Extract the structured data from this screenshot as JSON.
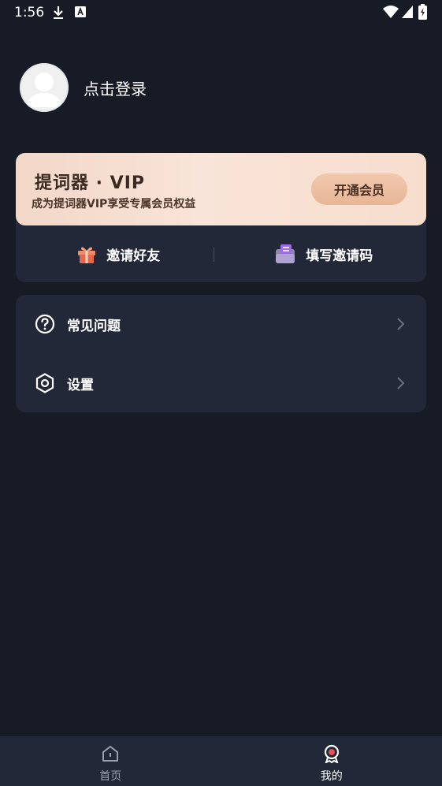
{
  "status_bar": {
    "time": "1:56"
  },
  "profile": {
    "login_label": "点击登录"
  },
  "vip": {
    "title": "提词器 · VIP",
    "subtitle": "成为提词器VIP享受专属会员权益",
    "button_label": "开通会员"
  },
  "invite": {
    "invite_friends_label": "邀请好友",
    "enter_code_label": "填写邀请码"
  },
  "menu": {
    "items": [
      {
        "label": "常见问题",
        "icon": "question-circle-icon"
      },
      {
        "label": "设置",
        "icon": "hexagon-settings-icon"
      }
    ]
  },
  "bottom_nav": {
    "items": [
      {
        "label": "首页",
        "icon": "home-icon",
        "active": false
      },
      {
        "label": "我的",
        "icon": "profile-badge-icon",
        "active": true
      }
    ]
  },
  "colors": {
    "background": "#161b26",
    "card": "#222837",
    "vip_gradient_start": "#f3d7c8",
    "vip_button": "#e8b596",
    "nav_inactive": "#9aa0ad"
  }
}
